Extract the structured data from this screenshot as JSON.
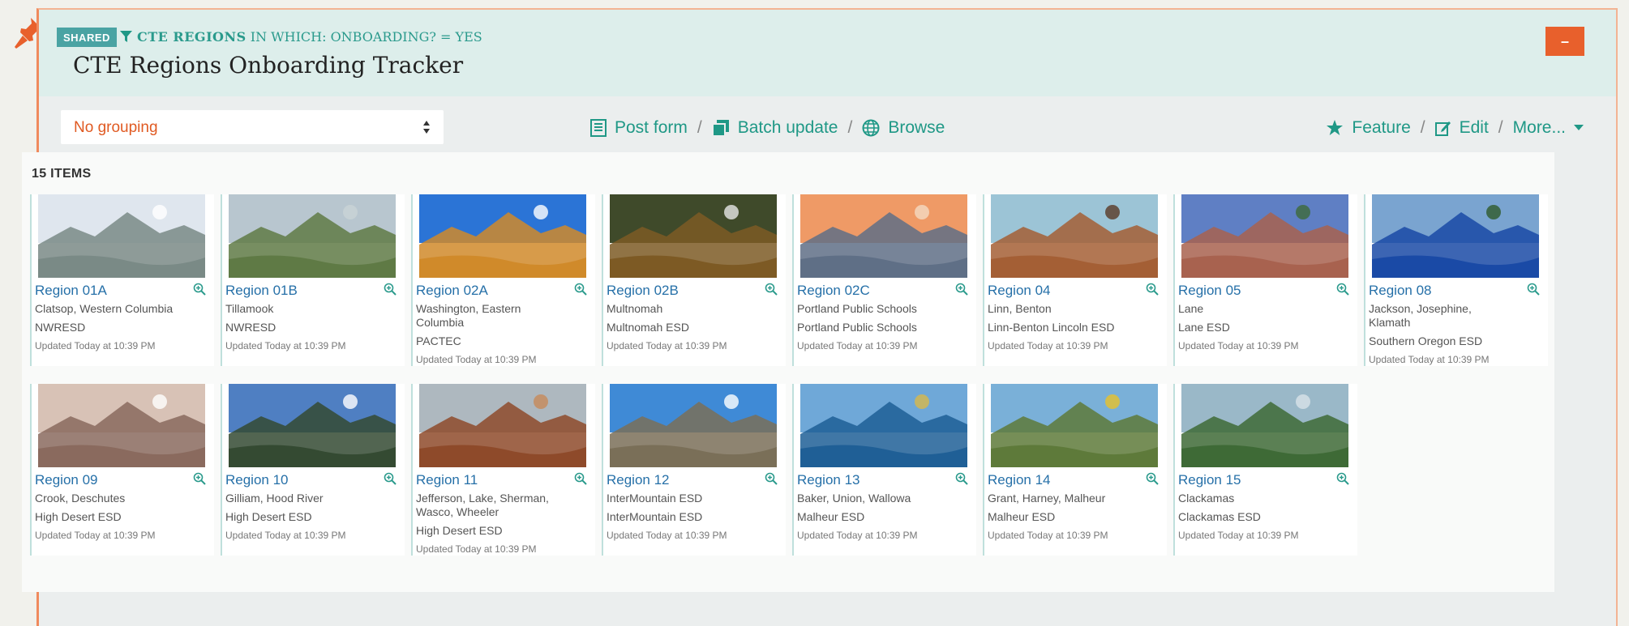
{
  "header": {
    "badge": "SHARED",
    "filter_bold": "CTE REGIONS",
    "filter_rest": "IN WHICH: ONBOARDING? = YES",
    "title": "CTE Regions Onboarding Tracker",
    "collapse_label": "–"
  },
  "toolbar": {
    "grouping_value": "No grouping",
    "post_form": "Post form",
    "batch_update": "Batch update",
    "browse": "Browse",
    "feature": "Feature",
    "edit": "Edit",
    "more": "More...",
    "sep": "/"
  },
  "items": {
    "count_label": "15 ITEMS",
    "updated": "Updated Today at 10:39 PM",
    "list": [
      {
        "name": "Region 01A",
        "counties": "Clatsop, Western Columbia",
        "org": "NWRESD",
        "sky": "#dfe6ee",
        "land": "#7a8a86",
        "accent": "#ffffff"
      },
      {
        "name": "Region 01B",
        "counties": "Tillamook",
        "org": "NWRESD",
        "sky": "#b8c6cf",
        "land": "#5f7a45",
        "accent": "#c9d3d6"
      },
      {
        "name": "Region 02A",
        "counties": "Washington, Eastern Columbia",
        "org": "PACTEC",
        "sky": "#2b74d6",
        "land": "#d08a2a",
        "accent": "#ffffff"
      },
      {
        "name": "Region 02B",
        "counties": "Multnomah",
        "org": "Multnomah ESD",
        "sky": "#3f4a2a",
        "land": "#7d5a24",
        "accent": "#e6e6e6"
      },
      {
        "name": "Region 02C",
        "counties": "Portland Public Schools",
        "org": "Portland Public Schools",
        "sky": "#ef9a66",
        "land": "#5f6f86",
        "accent": "#f4d9c2"
      },
      {
        "name": "Region 04",
        "counties": "Linn, Benton",
        "org": "Linn-Benton Lincoln ESD",
        "sky": "#9cc4d6",
        "land": "#a45f35",
        "accent": "#5a3a26"
      },
      {
        "name": "Region 05",
        "counties": "Lane",
        "org": "Lane ESD",
        "sky": "#5f7fc4",
        "land": "#a8624f",
        "accent": "#3d6a3a"
      },
      {
        "name": "Region 08",
        "counties": "Jackson, Josephine, Klamath",
        "org": "Southern Oregon ESD",
        "sky": "#7aa4d0",
        "land": "#1a4aa6",
        "accent": "#2f5a2a"
      },
      {
        "name": "Region 09",
        "counties": "Crook, Deschutes",
        "org": "High Desert ESD",
        "sky": "#d8c2b6",
        "land": "#8a6a5e",
        "accent": "#ffffff"
      },
      {
        "name": "Region 10",
        "counties": "Gilliam, Hood River",
        "org": "High Desert ESD",
        "sky": "#4f7fc2",
        "land": "#344a32",
        "accent": "#ffffff"
      },
      {
        "name": "Region 11",
        "counties": "Jefferson, Lake, Sherman, Wasco, Wheeler",
        "org": "High Desert ESD",
        "sky": "#aeb8bf",
        "land": "#8e4a2a",
        "accent": "#c78a5a"
      },
      {
        "name": "Region 12",
        "counties": "InterMountain ESD",
        "org": "InterMountain ESD",
        "sky": "#3f8ad6",
        "land": "#7a6f58",
        "accent": "#ffffff"
      },
      {
        "name": "Region 13",
        "counties": "Baker, Union, Wallowa",
        "org": "Malheur ESD",
        "sky": "#6fa8d8",
        "land": "#1f5f96",
        "accent": "#d8b84a"
      },
      {
        "name": "Region 14",
        "counties": "Grant, Harney, Malheur",
        "org": "Malheur ESD",
        "sky": "#7ab0d8",
        "land": "#5e7a3a",
        "accent": "#e8c22a"
      },
      {
        "name": "Region 15",
        "counties": "Clackamas",
        "org": "Clackamas ESD",
        "sky": "#9ab8c8",
        "land": "#3e6a36",
        "accent": "#d8e2e8"
      }
    ]
  }
}
